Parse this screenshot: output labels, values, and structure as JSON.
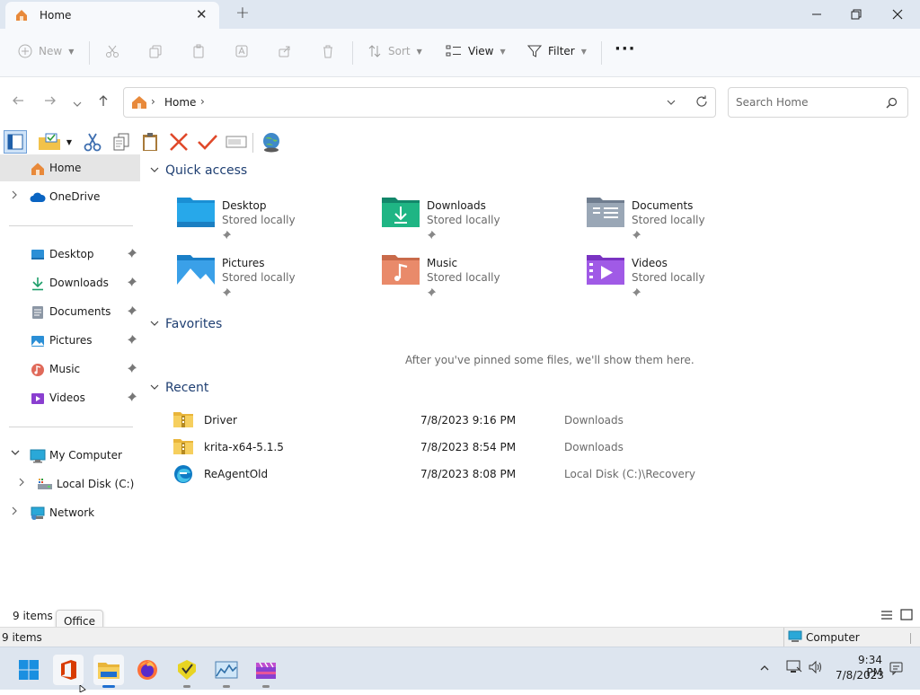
{
  "window": {
    "tab_title": "Home",
    "tab_close": "✕",
    "new_tab": "+",
    "minimize": "minimize",
    "maximize": "restore",
    "close": "close"
  },
  "command_bar": {
    "new_label": "New",
    "sort_label": "Sort",
    "view_label": "View",
    "filter_label": "Filter",
    "more_label": "···"
  },
  "address": {
    "crumbs": [
      "Home"
    ],
    "separator": "›"
  },
  "search": {
    "placeholder": "Search Home"
  },
  "nav_pane": {
    "home": "Home",
    "onedrive": "OneDrive",
    "pinned": [
      {
        "label": "Desktop",
        "icon": "desktop-icon"
      },
      {
        "label": "Downloads",
        "icon": "downloads-icon"
      },
      {
        "label": "Documents",
        "icon": "documents-icon"
      },
      {
        "label": "Pictures",
        "icon": "pictures-icon"
      },
      {
        "label": "Music",
        "icon": "music-icon"
      },
      {
        "label": "Videos",
        "icon": "videos-icon"
      }
    ],
    "my_computer": "My Computer",
    "local_disk": "Local Disk (C:)",
    "network": "Network"
  },
  "quick_access": {
    "heading": "Quick access",
    "items": [
      {
        "name": "Desktop",
        "sub": "Stored locally",
        "icon": "desktop-folder-icon"
      },
      {
        "name": "Downloads",
        "sub": "Stored locally",
        "icon": "downloads-folder-icon"
      },
      {
        "name": "Documents",
        "sub": "Stored locally",
        "icon": "documents-folder-icon"
      },
      {
        "name": "Pictures",
        "sub": "Stored locally",
        "icon": "pictures-folder-icon"
      },
      {
        "name": "Music",
        "sub": "Stored locally",
        "icon": "music-folder-icon"
      },
      {
        "name": "Videos",
        "sub": "Stored locally",
        "icon": "videos-folder-icon"
      }
    ]
  },
  "favorites": {
    "heading": "Favorites",
    "empty_message": "After you've pinned some files, we'll show them here."
  },
  "recent": {
    "heading": "Recent",
    "items": [
      {
        "name": "Driver",
        "date": "7/8/2023 9:16 PM",
        "location": "Downloads"
      },
      {
        "name": "krita-x64-5.1.5",
        "date": "7/8/2023 8:54 PM",
        "location": "Downloads"
      },
      {
        "name": "ReAgentOld",
        "date": "7/8/2023 8:08 PM",
        "location": "Local Disk (C:)\\Recovery"
      }
    ]
  },
  "status": {
    "items_count": "9 items",
    "tooltip": "Office",
    "items_count_bottom": "9 items",
    "computer_label": "Computer"
  },
  "taskbar": {
    "time": "9:34 PM",
    "date": "7/8/2023"
  },
  "colors": {
    "accent": "#0067c0",
    "header_blue": "#1f3f72",
    "folder_yellow": "#f4c542"
  }
}
